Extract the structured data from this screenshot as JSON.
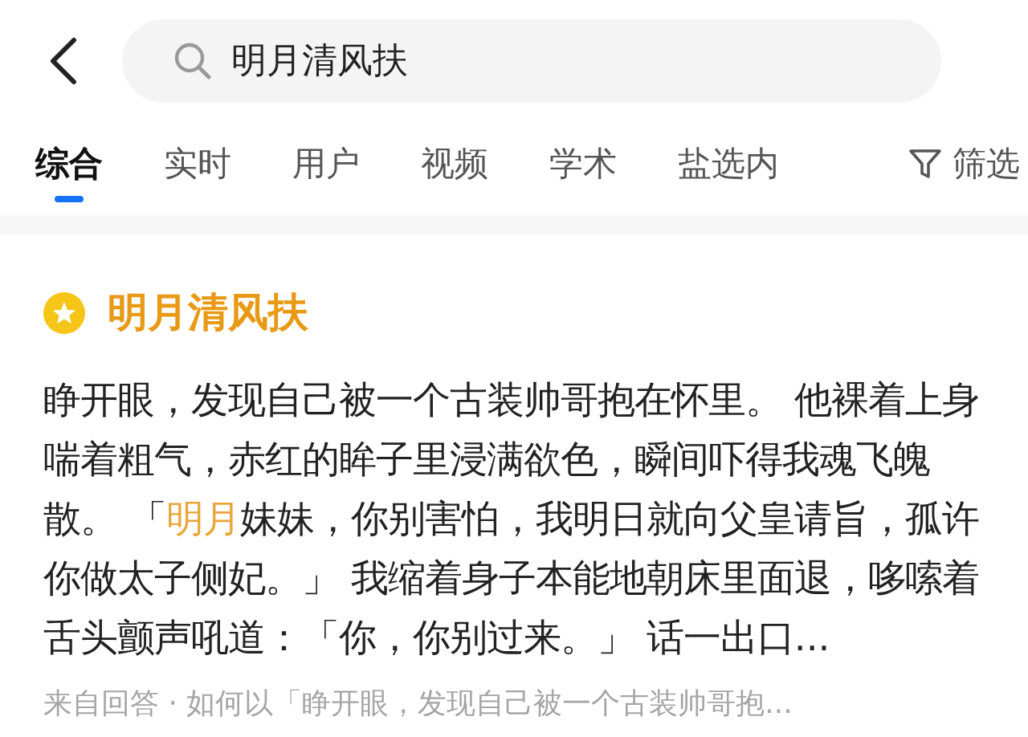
{
  "search": {
    "value": "明月清风扶"
  },
  "tabs": [
    {
      "label": "综合",
      "selected": true
    },
    {
      "label": "实时",
      "selected": false
    },
    {
      "label": "用户",
      "selected": false
    },
    {
      "label": "视频",
      "selected": false
    },
    {
      "label": "学术",
      "selected": false
    },
    {
      "label": "盐选内",
      "selected": false
    }
  ],
  "filter": {
    "label": "筛选"
  },
  "result": {
    "title": "明月清风扶",
    "body": [
      {
        "text": "睁开眼，发现自己被一个古装帅哥抱在怀里。 他裸着上身喘着粗气，赤红的眸子里浸满欲色，瞬间吓得我魂飞魄散。 「",
        "highlight": false
      },
      {
        "text": "明月",
        "highlight": true
      },
      {
        "text": "妹妹，你别害怕，我明日就向父皇请旨，孤许你做太子侧妃。」 我缩着身子本能地朝床里面退，哆嗦着舌头颤声吼道：「你，你别过来。」 话一出口...",
        "highlight": false
      }
    ],
    "source": "来自回答 · 如何以「睁开眼，发现自己被一个古装帅哥抱..."
  }
}
